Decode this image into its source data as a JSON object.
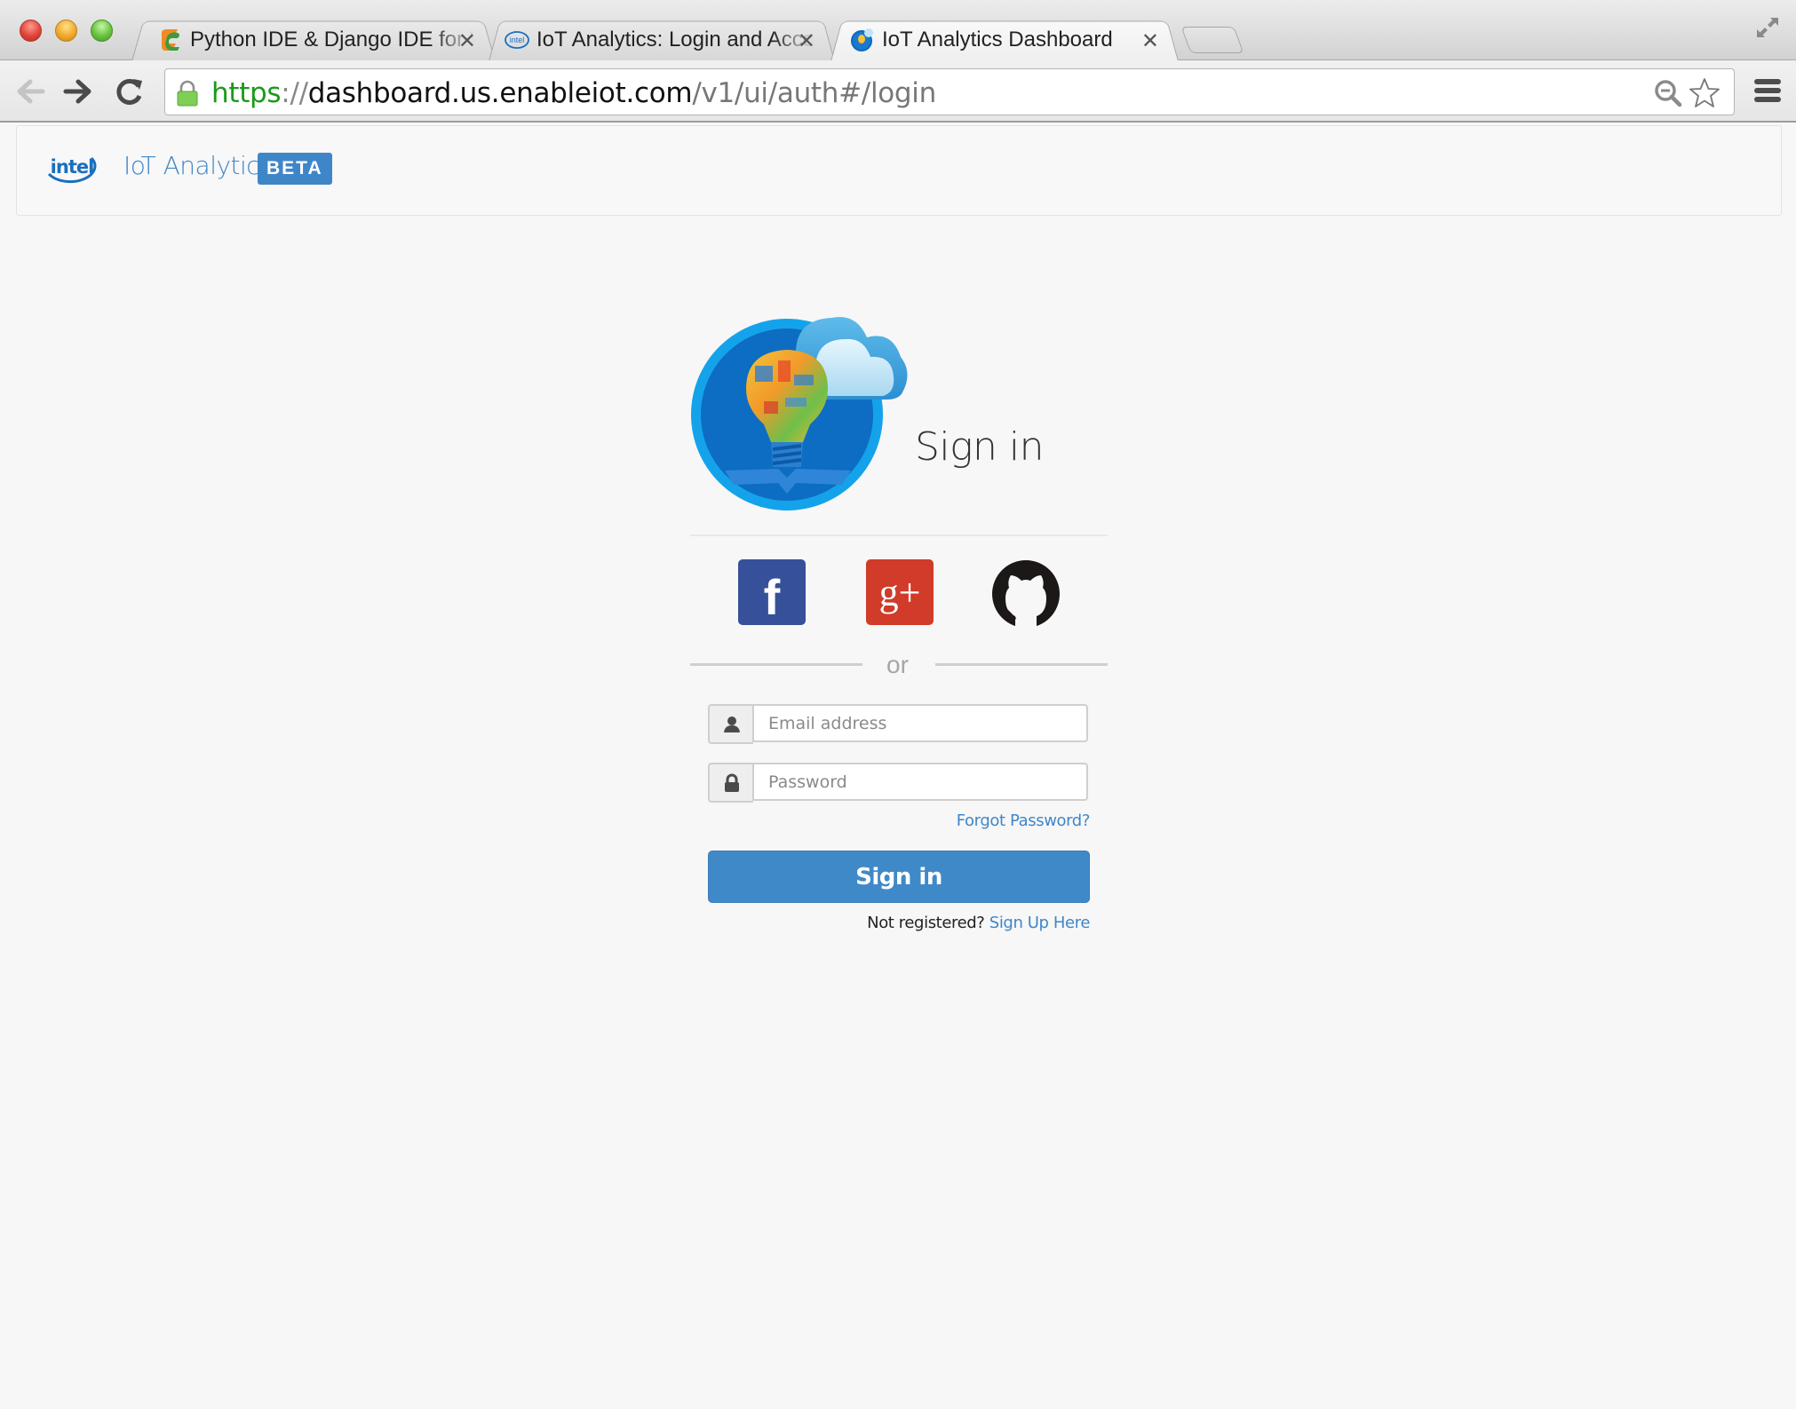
{
  "browser": {
    "tabs": [
      {
        "title": "Python IDE & Django IDE for Web developers",
        "favicon": "pycharm-icon",
        "active": false
      },
      {
        "title": "IoT Analytics: Login and Account",
        "favicon": "intel-icon",
        "active": false
      },
      {
        "title": "IoT Analytics Dashboard",
        "favicon": "iot-analytics-icon",
        "active": true
      }
    ],
    "close_glyph": "✕",
    "url": {
      "scheme": "https",
      "separator": "://",
      "host": "dashboard.us.enableiot.com",
      "path": "/v1/ui/auth#/login"
    }
  },
  "app_header": {
    "logo_text": "intel",
    "brand": "IoT Analytics",
    "badge": "BETA"
  },
  "login": {
    "heading": "Sign in",
    "social": [
      {
        "name": "facebook",
        "glyph": "f",
        "color": "#36519a"
      },
      {
        "name": "google-plus",
        "glyph": "g+",
        "color": "#d03b2a"
      },
      {
        "name": "github",
        "glyph": "",
        "color": "#1b1817"
      }
    ],
    "divider_text": "or",
    "email": {
      "placeholder": "Email address",
      "value": ""
    },
    "password": {
      "placeholder": "Password",
      "value": ""
    },
    "forgot_password": "Forgot Password?",
    "submit_label": "Sign in",
    "register_prompt": "Not registered?",
    "register_link": "Sign Up Here"
  },
  "colors": {
    "accent": "#3f86c9",
    "page_bg": "#f7f7f7",
    "url_scheme": "#1a9a1a"
  }
}
